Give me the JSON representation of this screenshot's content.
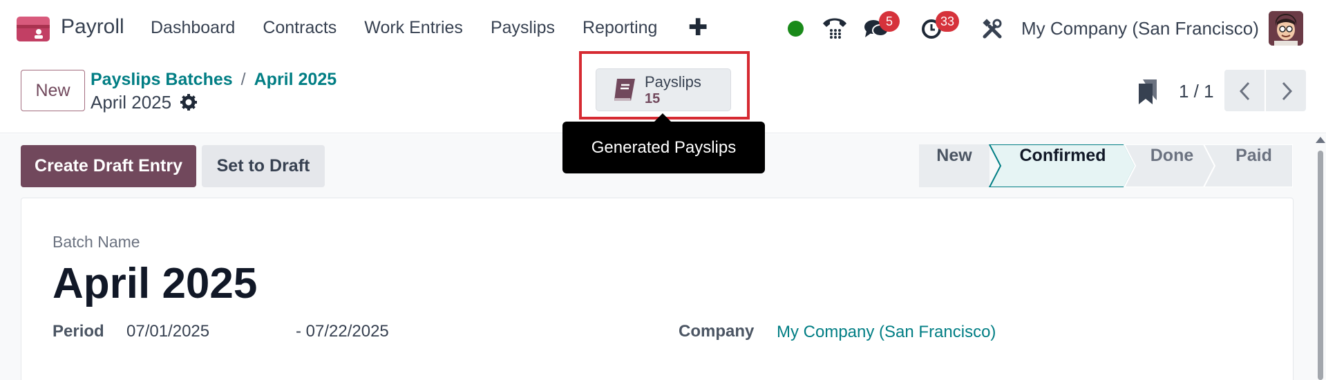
{
  "navbar": {
    "app_name": "Payroll",
    "menu": [
      "Dashboard",
      "Contracts",
      "Work Entries",
      "Payslips",
      "Reporting"
    ],
    "messages_count": "5",
    "activities_count": "33",
    "company": "My Company (San Francisco)"
  },
  "control_panel": {
    "new_label": "New",
    "breadcrumb": [
      "Payslips Batches",
      "April 2025"
    ],
    "breadcrumb_separator": "/",
    "record_title": "April 2025",
    "smart_button": {
      "label": "Payslips",
      "value": "15"
    },
    "tooltip": "Generated Payslips",
    "pager": "1 / 1"
  },
  "actions": {
    "primary": "Create Draft Entry",
    "secondary": "Set to Draft"
  },
  "statusbar": {
    "steps": [
      "New",
      "Confirmed",
      "Done",
      "Paid"
    ],
    "current": "Confirmed"
  },
  "form": {
    "batch_name_label": "Batch Name",
    "batch_name": "April 2025",
    "period_label": "Period",
    "period_start": "07/01/2025",
    "period_end": "- 07/22/2025",
    "company_label": "Company",
    "company_value": "My Company (San Francisco)"
  },
  "colors": {
    "brand": "#71485c",
    "link": "#017e84",
    "highlight": "#d62a32",
    "badge": "#d6323b",
    "status_current_bg": "#e6f4f4",
    "online": "#1a8a1a"
  },
  "icons": [
    "app-logo-icon",
    "plus-icon",
    "phone-icon",
    "chat-icon",
    "clock-icon",
    "tools-icon",
    "gear-icon",
    "book-icon",
    "bookmark-icon",
    "chevron-left-icon",
    "chevron-right-icon"
  ]
}
